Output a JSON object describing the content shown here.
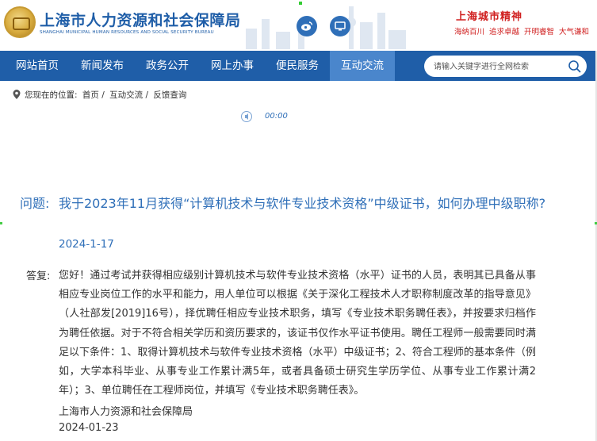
{
  "header": {
    "site_title": "上海市人力资源和社会保障局",
    "site_subtitle": "SHANGHAI MUNICIPAL HUMAN RESOURCES AND SOCIAL SECURITY BUREAU",
    "spirit_title": "上海城市精神",
    "spirit_words": "海纳百川  追求卓越  开明睿智  大气谦和"
  },
  "nav": {
    "items": [
      {
        "label": "网站首页"
      },
      {
        "label": "新闻发布"
      },
      {
        "label": "政务公开"
      },
      {
        "label": "网上办事"
      },
      {
        "label": "便民服务"
      },
      {
        "label": "互动交流"
      }
    ],
    "active_index": 5
  },
  "search": {
    "placeholder": "请输入关键字进行全网检索"
  },
  "breadcrumb": {
    "prefix": "您现在的位置:",
    "items": [
      "首页 /",
      "互动交流 /",
      "反馈查询"
    ]
  },
  "audio": {
    "time": "00:00"
  },
  "question": {
    "label": "问题:",
    "text": "我于2023年11月获得“计算机技术与软件专业技术资格”中级证书，如何办理中级职称?",
    "date": "2024-1-17"
  },
  "answer": {
    "label": "答复:",
    "text": "您好！通过考试并获得相应级别计算机技术与软件专业技术资格（水平）证书的人员，表明其已具备从事相应专业岗位工作的水平和能力，用人单位可以根据《关于深化工程技术人才职称制度改革的指导意见》（人社部发[2019]16号），择优聘任相应专业技术职务，填写《专业技术职务聘任表》，并按要求归档作为聘任依据。对于不符合相关学历和资历要求的，该证书仅作水平证书使用。聘任工程师一般需要同时满足以下条件：1、取得计算机技术与软件专业技术资格（水平）中级证书；2、符合工程师的基本条件（例如，大学本科毕业、从事专业工作累计满5年，或者具备硕士研究生学历学位、从事专业工作累计满2年）；3、单位聘任在工程师岗位，并填写《专业技术职务聘任表》。",
    "org": "上海市人力资源和社会保障局",
    "date": "2024-01-23"
  },
  "colors": {
    "primary": "#1f5ea8",
    "nav_active": "#4a86cc",
    "link_text": "#2f6fb8",
    "spirit_red": "#d02020"
  }
}
